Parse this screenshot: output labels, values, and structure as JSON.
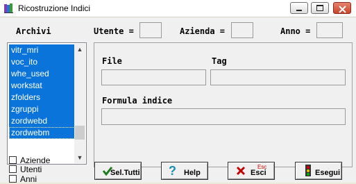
{
  "window": {
    "title": "Ricostruzione Indici"
  },
  "header": {
    "archivi_label": "Archivi",
    "utente_label": "Utente =",
    "utente_value": "",
    "azienda_label": "Azienda =",
    "azienda_value": "",
    "anno_label": "Anno =",
    "anno_value": ""
  },
  "archivi_list": {
    "items": [
      "vitr_mri",
      "voc_ito",
      "whe_used",
      "workstat",
      "zfolders",
      "zgruppi",
      "zordwebd",
      "zordwebm"
    ]
  },
  "detail": {
    "file_label": "File",
    "file_value": "",
    "tag_label": "Tag",
    "tag_value": "",
    "formula_label": "Formula indice",
    "formula_value": ""
  },
  "options": [
    {
      "label": "Aziende",
      "checked": false
    },
    {
      "label": "Utenti",
      "checked": false
    },
    {
      "label": "Anni",
      "checked": false
    }
  ],
  "buttons": {
    "sel_tutti": "Sel.Tutti",
    "help": "Help",
    "esci": "Esci",
    "esci_shortcut": "Esc",
    "esegui": "Esegui"
  }
}
